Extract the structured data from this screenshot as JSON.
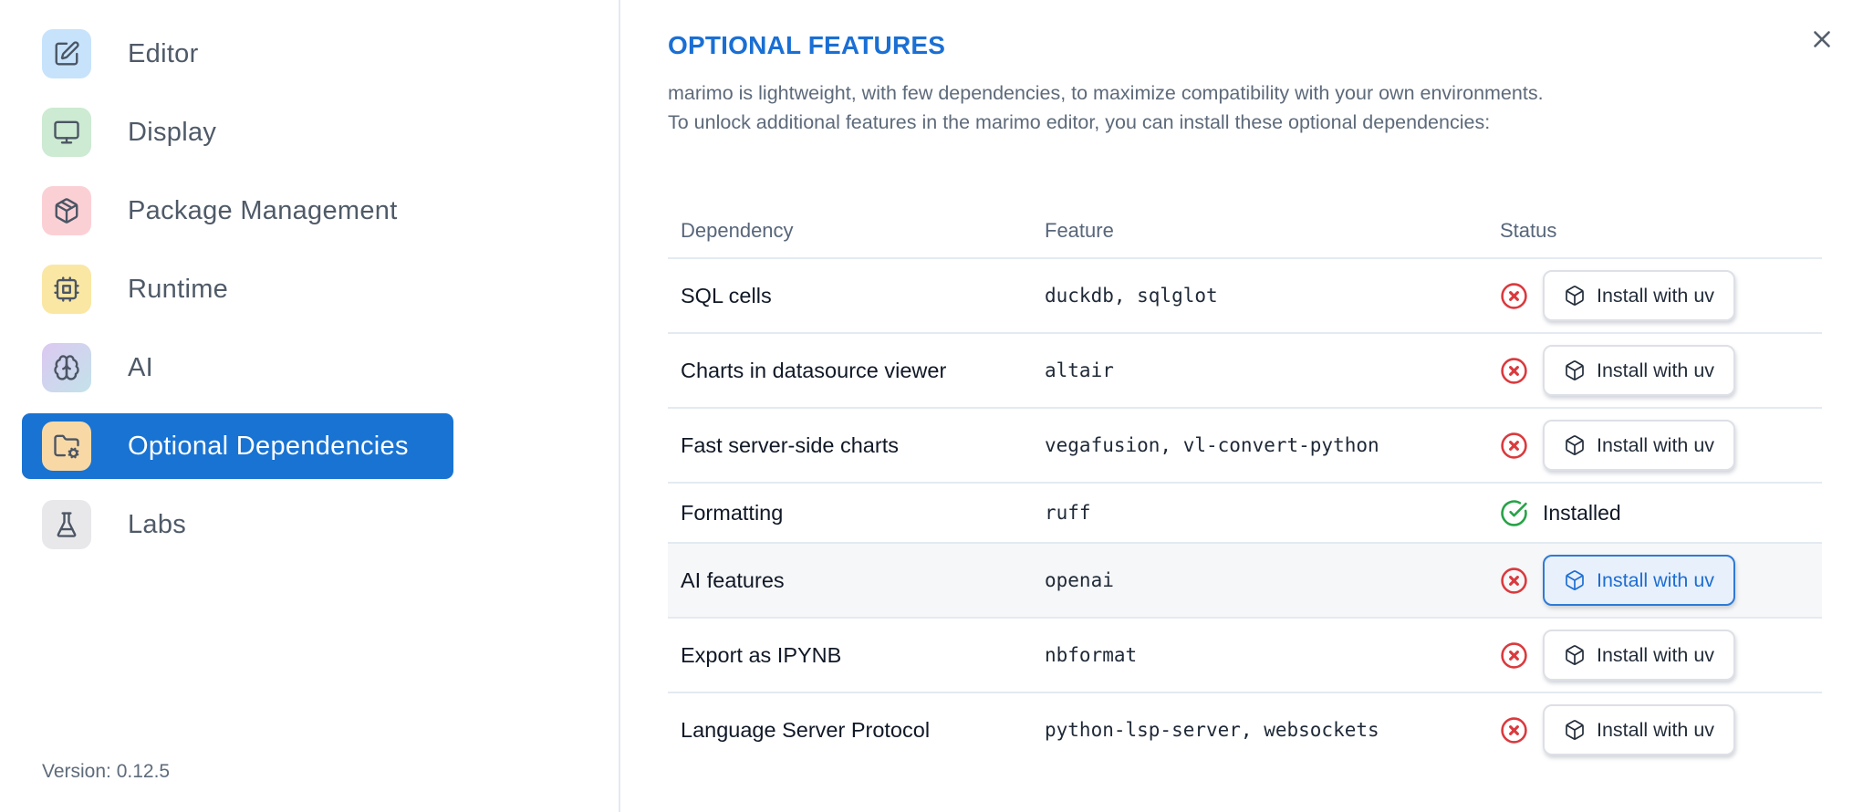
{
  "sidebar": {
    "items": [
      {
        "label": "Editor",
        "icon": "edit-icon"
      },
      {
        "label": "Display",
        "icon": "monitor-icon"
      },
      {
        "label": "Package Management",
        "icon": "package-icon"
      },
      {
        "label": "Runtime",
        "icon": "cpu-icon"
      },
      {
        "label": "AI",
        "icon": "brain-icon"
      },
      {
        "label": "Optional Dependencies",
        "icon": "folder-cog-icon",
        "selected": true
      },
      {
        "label": "Labs",
        "icon": "flask-icon"
      }
    ],
    "version_label": "Version: 0.12.5"
  },
  "main": {
    "title": "OPTIONAL FEATURES",
    "description_lines": [
      "marimo is lightweight, with few dependencies, to maximize compatibility with your own environments.",
      "To unlock additional features in the marimo editor, you can install these optional dependencies:"
    ],
    "table": {
      "columns": [
        "Dependency",
        "Feature",
        "Status"
      ],
      "rows": [
        {
          "dependency": "SQL cells",
          "feature": "duckdb, sqlglot",
          "installed": false,
          "action_label": "Install with uv"
        },
        {
          "dependency": "Charts in datasource viewer",
          "feature": "altair",
          "installed": false,
          "action_label": "Install with uv"
        },
        {
          "dependency": "Fast server-side charts",
          "feature": "vegafusion, vl-convert-python",
          "installed": false,
          "action_label": "Install with uv"
        },
        {
          "dependency": "Formatting",
          "feature": "ruff",
          "installed": true,
          "status_label": "Installed"
        },
        {
          "dependency": "AI features",
          "feature": "openai",
          "installed": false,
          "action_label": "Install with uv",
          "highlighted": true
        },
        {
          "dependency": "Export as IPYNB",
          "feature": "nbformat",
          "installed": false,
          "action_label": "Install with uv"
        },
        {
          "dependency": "Language Server Protocol",
          "feature": "python-lsp-server, websockets",
          "installed": false,
          "action_label": "Install with uv"
        }
      ]
    }
  },
  "colors": {
    "accent_blue": "#1a6fd4",
    "selected_item_bg": "#1873d3",
    "error_red": "#da3a3e",
    "success_green": "#27a348",
    "highlighted_button_border": "#2e7ad6",
    "highlighted_button_bg": "#e8f0fc",
    "row_highlight_bg": "#f6f7f8",
    "icon_bg_editor": "#c7e3fb",
    "icon_bg_display": "#cdead2",
    "icon_bg_package": "#fbd0d5",
    "icon_bg_runtime": "#fae7a4",
    "icon_bg_optional_deps": "#f8d9a6",
    "icon_bg_labs": "#e8e8eb"
  }
}
